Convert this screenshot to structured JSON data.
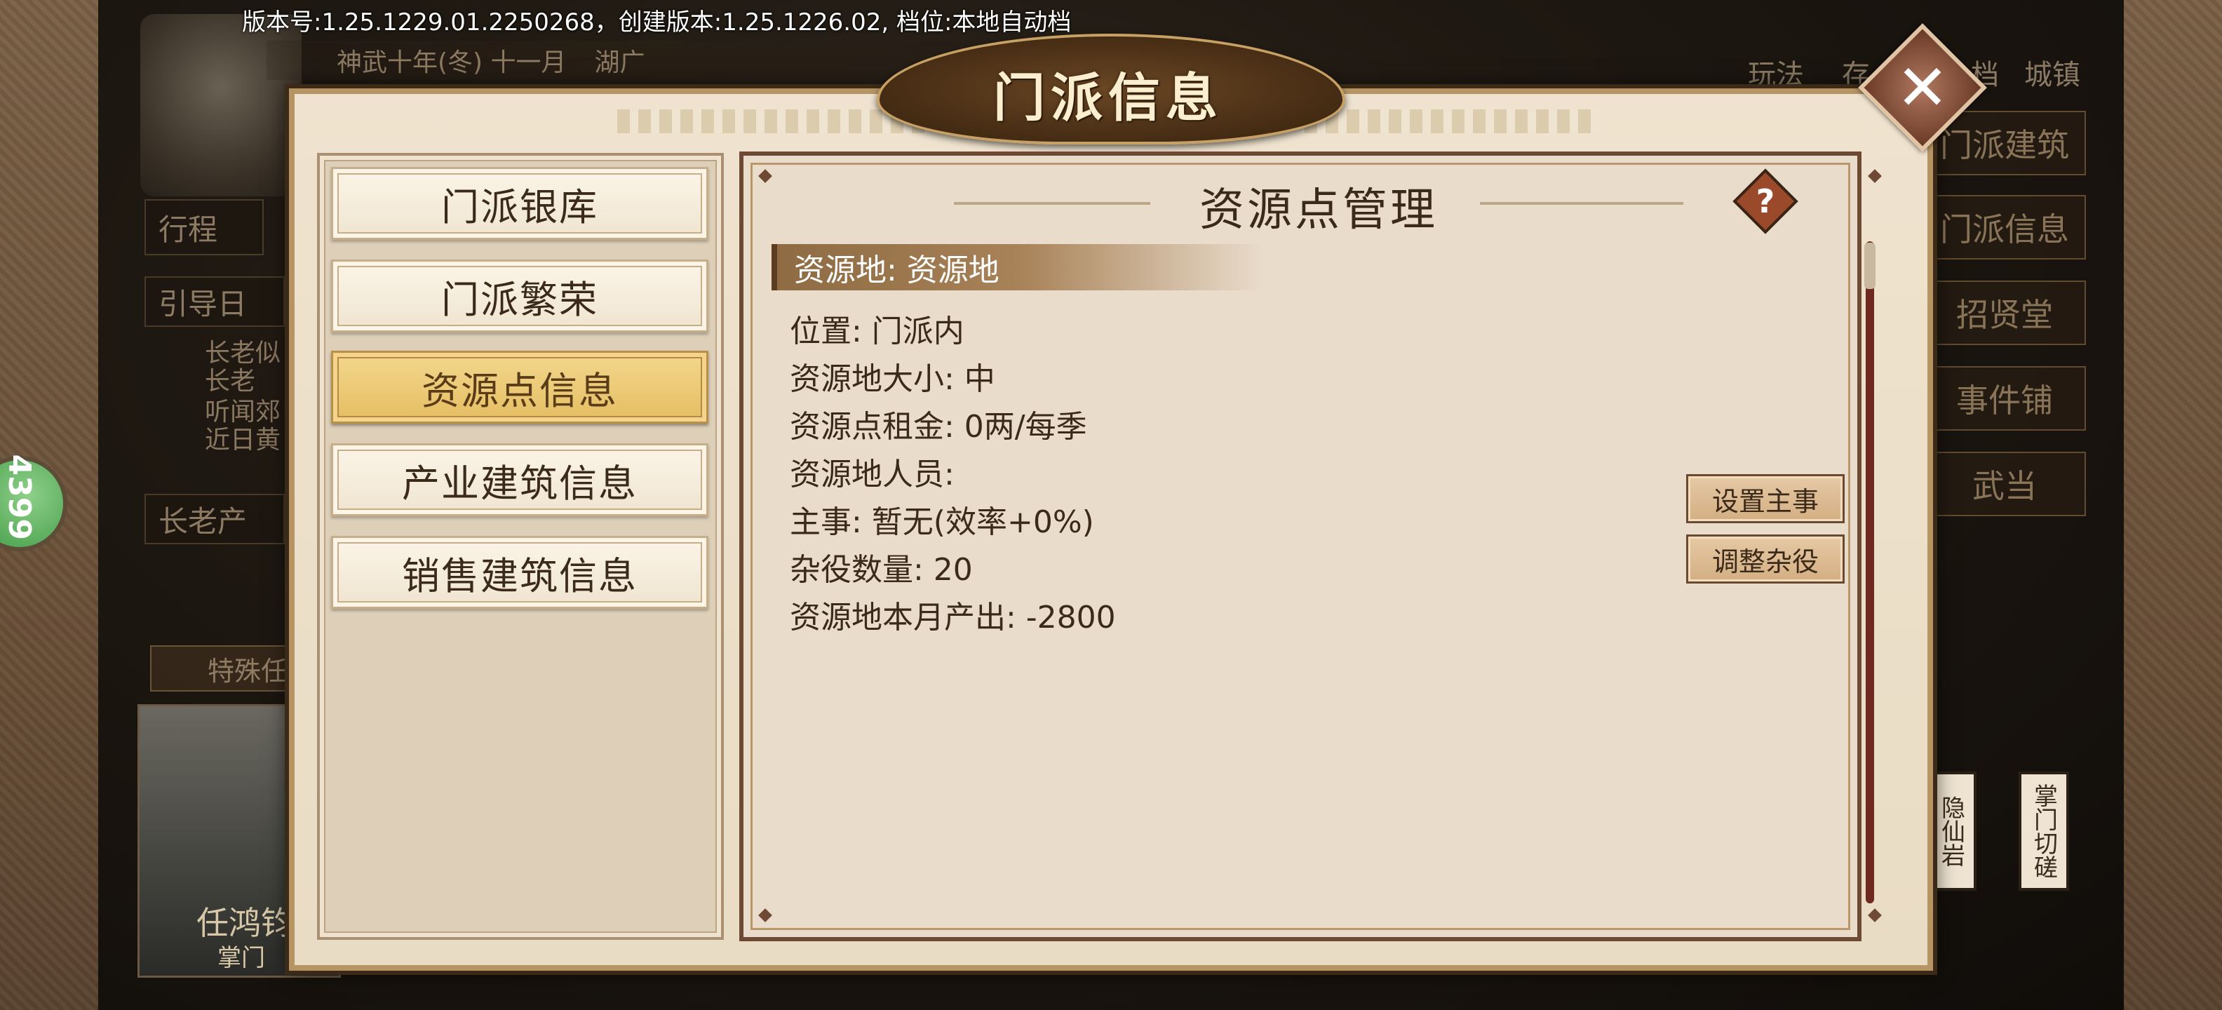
{
  "version_text": "版本号:1.25.1229.01.2250268，创建版本:1.25.1226.02, 档位:本地自动档",
  "date_bar": {
    "date": "神武十年(冬) 十一月",
    "region": "湖广"
  },
  "background": {
    "left_box_1": "行程",
    "left_box_2": "引导日",
    "log_lines": [
      "长老似",
      "长老",
      "听闻郊",
      "近日黄"
    ],
    "left_box_3": "长老产",
    "special_task": "特殊任",
    "badge_number": "4399",
    "character": {
      "name": "任鸿钧",
      "role": "掌门"
    },
    "top_right": [
      "玩法",
      "存",
      "档",
      "城镇"
    ],
    "right_menu": [
      "门派建筑",
      "门派信息",
      "招贤堂",
      "事件铺",
      "武当"
    ],
    "vertical_buttons": [
      "隐仙岩",
      "掌门切磋"
    ]
  },
  "modal": {
    "title": "门派信息",
    "close_symbol": "✕",
    "tabs": [
      {
        "label": "门派银库",
        "active": false
      },
      {
        "label": "门派繁荣",
        "active": false
      },
      {
        "label": "资源点信息",
        "active": true
      },
      {
        "label": "产业建筑信息",
        "active": false
      },
      {
        "label": "销售建筑信息",
        "active": false
      }
    ],
    "panel_title": "资源点管理",
    "help_symbol": "?",
    "section_header": "资源地: 资源地",
    "info": {
      "location": "位置: 门派内",
      "size": "资源地大小: 中",
      "rent": "资源点租金: 0两/每季",
      "staff": "资源地人员:",
      "manager": "主事: 暂无(效率+0%)",
      "laborers": "杂役数量: 20",
      "output": "资源地本月产出: -2800"
    },
    "buttons": {
      "set_manager": "设置主事",
      "adjust_laborers": "调整杂役"
    }
  },
  "colors": {
    "active_tab": "#e5bd62",
    "panel_border": "#6e4a34",
    "text": "#3b2a1a",
    "scrollbar": "#6e2a20"
  }
}
